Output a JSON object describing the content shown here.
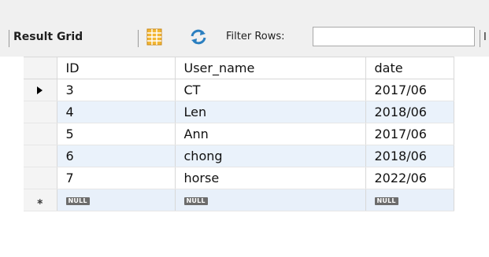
{
  "toolbar": {
    "result_grid_label": "Result Grid",
    "filter_label": "Filter Rows:",
    "filter_value": "",
    "cut_label": "I"
  },
  "grid": {
    "columns": [
      "ID",
      "User_name",
      "date"
    ],
    "rows": [
      {
        "id": "3",
        "user_name": "CT",
        "date": "2017/06"
      },
      {
        "id": "4",
        "user_name": "Len",
        "date": "2018/06"
      },
      {
        "id": "5",
        "user_name": "Ann",
        "date": "2017/06"
      },
      {
        "id": "6",
        "user_name": "chong",
        "date": "2018/06"
      },
      {
        "id": "7",
        "user_name": "horse",
        "date": "2022/06"
      }
    ],
    "new_row": {
      "id": "NULL",
      "user_name": "NULL",
      "date": "NULL"
    },
    "current_row_marker": "arrow-right-icon",
    "new_row_marker": "asterisk-icon"
  },
  "colors": {
    "toolbar_bg": "#f0f0f0",
    "alt_row_bg": "#eaf2fb",
    "null_badge_bg": "#6c6c6c",
    "refresh_icon": "#2b7fc0",
    "grid_icon": "#f2b632"
  }
}
